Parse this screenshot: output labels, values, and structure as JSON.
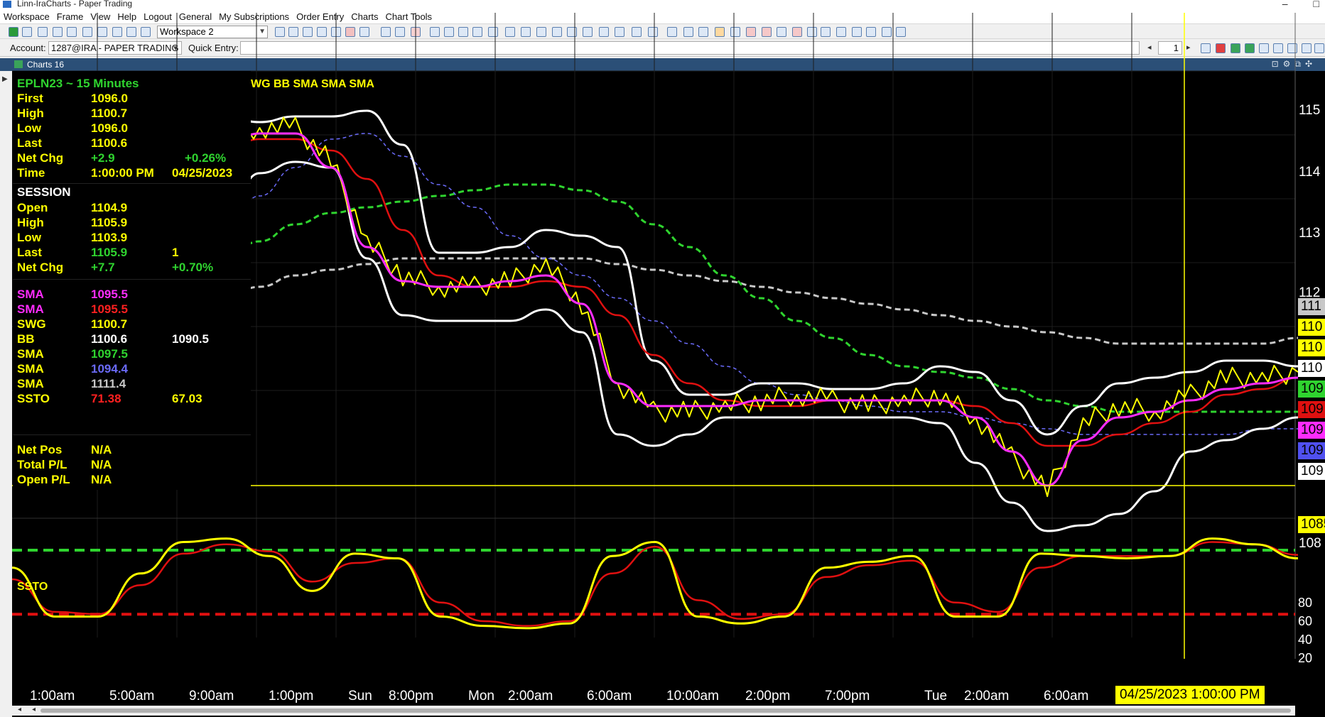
{
  "window": {
    "title": "Linn-IraCharts - Paper Trading"
  },
  "menu": [
    "Workspace",
    "Frame",
    "View",
    "Help",
    "Logout",
    "General",
    "My Subscriptions",
    "Order Entry",
    "Charts",
    "Chart Tools"
  ],
  "toolbar": {
    "workspace_value": "Workspace 2"
  },
  "account_bar": {
    "account_label": "Account:",
    "account_value": "1287@IRA - PAPER TRADING",
    "quick_entry_label": "Quick Entry:",
    "quick_entry_value": "",
    "page_value": "1"
  },
  "chart_window": {
    "title": "Charts 16"
  },
  "info": {
    "symbol": "EPLN23 ~ 15 Minutes",
    "bar": [
      {
        "label": "First",
        "value": "1096.0",
        "extra": ""
      },
      {
        "label": "High",
        "value": "1100.7",
        "extra": ""
      },
      {
        "label": "Low",
        "value": "1096.0",
        "extra": ""
      },
      {
        "label": "Last",
        "value": "1100.6",
        "extra": ""
      },
      {
        "label": "Net Chg",
        "value": "+2.9",
        "extra": "+0.26%"
      },
      {
        "label": "Time",
        "value": "1:00:00 PM",
        "extra": "04/25/2023"
      }
    ],
    "session_title": "SESSION",
    "session": [
      {
        "label": "Open",
        "value": "1104.9",
        "extra": ""
      },
      {
        "label": "High",
        "value": "1105.9",
        "extra": ""
      },
      {
        "label": "Low",
        "value": "1103.9",
        "extra": ""
      },
      {
        "label": "Last",
        "value": "1105.9",
        "extra": "1"
      },
      {
        "label": "Net Chg",
        "value": "+7.7",
        "extra": "+0.70%"
      }
    ],
    "studies": [
      {
        "label": "SMA",
        "value": "1095.5",
        "extra": "",
        "color": "#ff2cff"
      },
      {
        "label": "SMA",
        "value": "1095.5",
        "extra": "",
        "color": "#ff2020"
      },
      {
        "label": "SWG",
        "value": "1100.7",
        "extra": "",
        "color": "#ffff00"
      },
      {
        "label": "BB",
        "value": "1100.6",
        "extra": "1090.5",
        "color": "#ffffff"
      },
      {
        "label": "SMA",
        "value": "1097.5",
        "extra": "",
        "color": "#2fd42f"
      },
      {
        "label": "SMA",
        "value": "1094.4",
        "extra": "",
        "color": "#6a6af8"
      },
      {
        "label": "SMA",
        "value": "1111.4",
        "extra": "",
        "color": "#c8c8c8"
      },
      {
        "label": "SSTO",
        "value": "71.38",
        "extra": "67.03",
        "color": "#ff2020"
      }
    ],
    "position": [
      {
        "label": "Net Pos",
        "value": "N/A"
      },
      {
        "label": "Total P/L",
        "value": "N/A"
      },
      {
        "label": "Open P/L",
        "value": "N/A"
      }
    ]
  },
  "study_label": "WG BB SMA SMA SMA",
  "ssto_label": "SSTO",
  "price_axis": {
    "ticks": [
      "115",
      "114",
      "113",
      "112",
      "108"
    ],
    "tags": [
      {
        "text": "111",
        "bg": "#c8c8c8",
        "fg": "#000000"
      },
      {
        "text": "110",
        "bg": "#ffff00",
        "fg": "#000000"
      },
      {
        "text": "110",
        "bg": "#ffff00",
        "fg": "#000000"
      },
      {
        "text": "110",
        "bg": "#ffffff",
        "fg": "#000000"
      },
      {
        "text": "109",
        "bg": "#2fd42f",
        "fg": "#000000"
      },
      {
        "text": "109",
        "bg": "#e01010",
        "fg": "#000000"
      },
      {
        "text": "109",
        "bg": "#ff2cff",
        "fg": "#000000"
      },
      {
        "text": "109",
        "bg": "#5050f0",
        "fg": "#000000"
      },
      {
        "text": "109",
        "bg": "#ffffff",
        "fg": "#000000"
      },
      {
        "text": "1085",
        "bg": "#ffff00",
        "fg": "#000000"
      }
    ]
  },
  "osc_axis": {
    "ticks": [
      "80",
      "60",
      "40",
      "20"
    ]
  },
  "time_axis": {
    "labels": [
      "1:00am",
      "5:00am",
      "9:00am",
      "1:00pm",
      "Sun",
      "8:00pm",
      "Mon",
      "2:00am",
      "6:00am",
      "10:00am",
      "2:00pm",
      "7:00pm",
      "Tue",
      "2:00am",
      "6:00am"
    ],
    "cursor_label": "04/25/2023 1:00:00 PM"
  },
  "colors": {
    "price": "#ffff00",
    "sma_fast": "#ff2cff",
    "sma_red": "#e01010",
    "bollinger": "#ffffff",
    "sma_green": "#2fd42f",
    "sma_blue": "#6a6af8",
    "sma_gray": "#c8c8c8",
    "ssto_k": "#ffff00",
    "ssto_d": "#e01010",
    "crosshair": "#ffff00"
  },
  "chart_data": {
    "type": "line",
    "symbol": "EPLN23",
    "interval": "15 Minutes",
    "x_axis_labels": [
      "1:00am",
      "5:00am",
      "9:00am",
      "1:00pm",
      "Sun 8:00pm",
      "Mon 2:00am",
      "6:00am",
      "10:00am",
      "2:00pm",
      "7:00pm",
      "Tue 2:00am",
      "6:00am"
    ],
    "price_range": [
      1082,
      1158
    ],
    "series": [
      {
        "name": "price",
        "values": [
          1147,
          1148,
          1148,
          1142,
          1128,
          1122,
          1120,
          1120,
          1121,
          1124,
          1117,
          1103,
          1098,
          1098,
          1099,
          1100,
          1101,
          1100,
          1099,
          1100,
          1101,
          1097,
          1090,
          1084,
          1096,
          1099,
          1098,
          1101,
          1104,
          1104,
          1105
        ]
      },
      {
        "name": "sma_fast",
        "values": [
          1145,
          1147,
          1147,
          1141,
          1127,
          1121,
          1120,
          1120,
          1121,
          1122,
          1117,
          1103,
          1099,
          1099,
          1099,
          1100,
          1100,
          1100,
          1100,
          1100,
          1100,
          1097,
          1091,
          1085,
          1093,
          1097,
          1098,
          1100,
          1102,
          1103,
          1104
        ]
      },
      {
        "name": "sma_red",
        "values": [
          1144,
          1146,
          1146,
          1144,
          1139,
          1130,
          1122,
          1120,
          1120,
          1121,
          1120,
          1115,
          1108,
          1103,
          1100,
          1099,
          1099,
          1100,
          1100,
          1100,
          1100,
          1099,
          1096,
          1092,
          1092,
          1094,
          1096,
          1098,
          1101,
          1102,
          1104
        ]
      },
      {
        "name": "sma_green",
        "values": [
          1125,
          1128,
          1131,
          1133,
          1134,
          1135,
          1136,
          1137,
          1138,
          1138,
          1137,
          1135,
          1131,
          1127,
          1122,
          1118,
          1114,
          1111,
          1108,
          1106,
          1105,
          1104,
          1102,
          1100,
          1099,
          1098,
          1098,
          1098,
          1098,
          1098,
          1098
        ]
      },
      {
        "name": "sma_blue",
        "values": [
          1130,
          1136,
          1141,
          1146,
          1147,
          1143,
          1138,
          1134,
          1129,
          1125,
          1122,
          1118,
          1114,
          1110,
          1106,
          1103,
          1101,
          1100,
          1099,
          1098,
          1098,
          1097,
          1096,
          1095,
          1094,
          1094,
          1094,
          1094,
          1094,
          1095,
          1095
        ]
      },
      {
        "name": "sma_gray",
        "values": [
          1118,
          1120,
          1122,
          1123,
          1124,
          1125,
          1125,
          1125,
          1125,
          1125,
          1125,
          1124,
          1123,
          1122,
          1121,
          1120,
          1119,
          1118,
          1117,
          1116,
          1115,
          1114,
          1113,
          1112,
          1111,
          1110,
          1110,
          1110,
          1110,
          1110,
          1111
        ]
      },
      {
        "name": "bb_upper",
        "values": [
          1150,
          1149,
          1150,
          1150,
          1151,
          1145,
          1126,
          1126,
          1127,
          1130,
          1129,
          1127,
          1107,
          1101,
          1101,
          1103,
          1103,
          1102,
          1102,
          1103,
          1106,
          1105,
          1100,
          1094,
          1099,
          1103,
          1104,
          1105,
          1107,
          1107,
          1106
        ]
      },
      {
        "name": "bb_lower",
        "values": [
          1132,
          1140,
          1142,
          1141,
          1125,
          1115,
          1114,
          1114,
          1114,
          1116,
          1112,
          1094,
          1092,
          1094,
          1097,
          1097,
          1097,
          1097,
          1097,
          1097,
          1096,
          1089,
          1082,
          1077,
          1078,
          1080,
          1084,
          1091,
          1093,
          1095,
          1097
        ]
      }
    ],
    "crosshair_price": 1085,
    "ssto": {
      "levels": {
        "overbought": 75,
        "oversold": 20
      },
      "range": [
        0,
        100
      ],
      "k": [
        60,
        18,
        18,
        55,
        82,
        85,
        70,
        40,
        72,
        68,
        18,
        10,
        8,
        12,
        70,
        82,
        18,
        12,
        18,
        60,
        65,
        70,
        18,
        18,
        72,
        70,
        68,
        70,
        85,
        80,
        68
      ],
      "d": [
        50,
        22,
        20,
        45,
        72,
        80,
        74,
        48,
        64,
        68,
        30,
        14,
        10,
        14,
        55,
        78,
        32,
        16,
        20,
        52,
        62,
        66,
        30,
        22,
        60,
        70,
        70,
        70,
        82,
        80,
        71
      ]
    }
  }
}
